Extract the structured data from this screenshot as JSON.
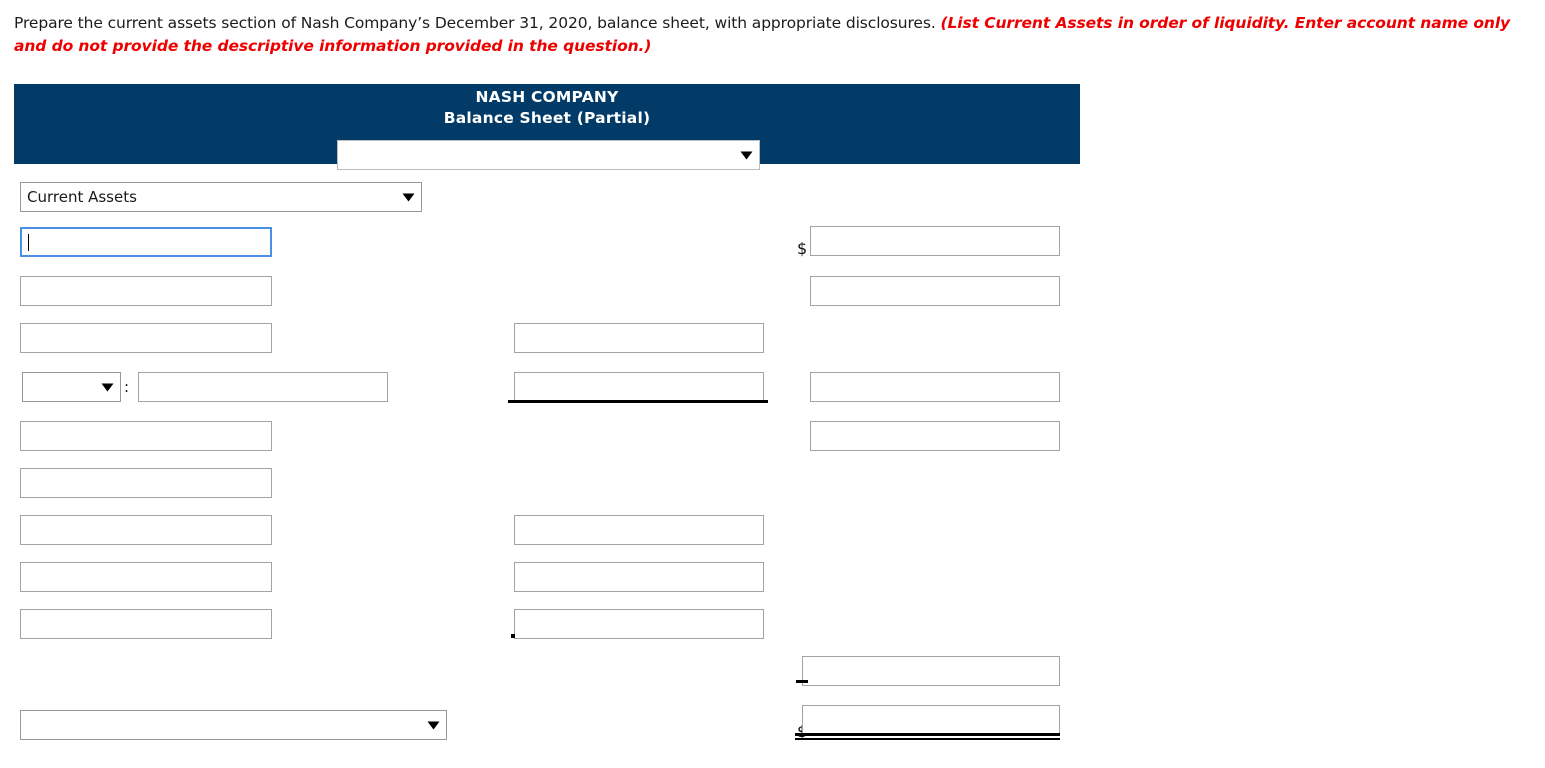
{
  "prompt": {
    "main": "Prepare the current assets section of Nash Company’s December 31, 2020, balance sheet, with appropriate disclosures.",
    "hint": "(List Current Assets in order of liquidity. Enter account name only and do not provide the descriptive information provided in the question.)"
  },
  "sheet": {
    "company_name": "NASH COMPANY",
    "title": "Balance Sheet (Partial)",
    "header_color": "#023B67",
    "date_select": {
      "value": "",
      "placeholder": ""
    },
    "section_select": {
      "value": "Current Assets"
    },
    "bottom_select": {
      "value": ""
    },
    "inline_select": {
      "value": ""
    },
    "colon": ":",
    "currency_symbol": "$"
  },
  "rows": [
    {
      "id": "row-1",
      "account": "",
      "middle": null,
      "right": "",
      "right_dollar": true
    },
    {
      "id": "row-2",
      "account": "",
      "middle": null,
      "right": "",
      "right_dollar": false
    },
    {
      "id": "row-3",
      "account": "",
      "middle": "",
      "right": null,
      "right_dollar": false
    },
    {
      "id": "row-4",
      "account": "",
      "middle": "",
      "right": "",
      "right_dollar": false,
      "has_inline_select": true,
      "middle_underline": true
    },
    {
      "id": "row-5",
      "account": "",
      "middle": null,
      "right": "",
      "right_dollar": false
    },
    {
      "id": "row-6",
      "account": "",
      "middle": null,
      "right": null,
      "right_dollar": false
    },
    {
      "id": "row-7",
      "account": "",
      "middle": "",
      "right": null,
      "right_dollar": false
    },
    {
      "id": "row-8",
      "account": "",
      "middle": "",
      "right": null,
      "right_dollar": false
    },
    {
      "id": "row-9",
      "account": "",
      "middle": "",
      "right": null,
      "right_dollar": false
    },
    {
      "id": "row-subtotal",
      "account": null,
      "middle": null,
      "right": "",
      "right_dollar": false
    },
    {
      "id": "row-total",
      "account": null,
      "middle": null,
      "right": "",
      "right_dollar": true
    }
  ]
}
